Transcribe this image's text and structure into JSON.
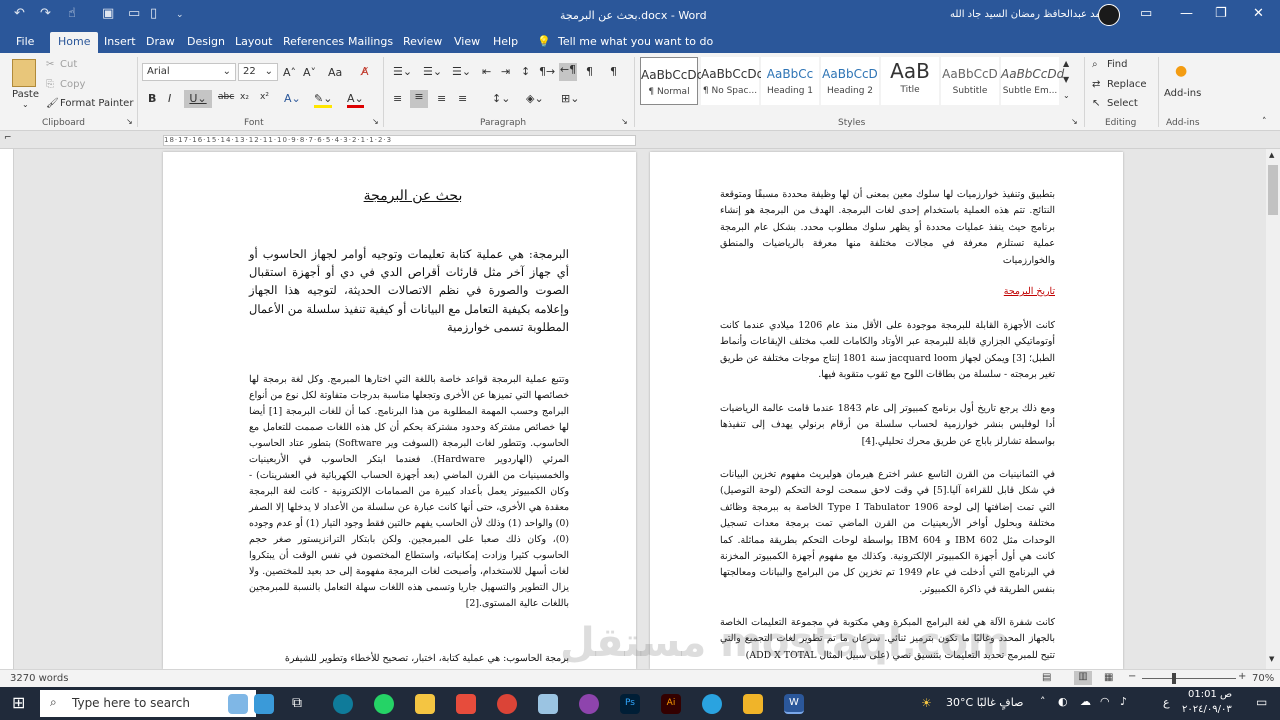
{
  "title_bar": {
    "doc_title": "بحث عن البرمجة.docx  -  Word",
    "user_name": "محمد عبدالحافظ رمضان السيد جاد الله"
  },
  "tabs": [
    "File",
    "Home",
    "Insert",
    "Draw",
    "Design",
    "Layout",
    "References",
    "Mailings",
    "Review",
    "View",
    "Help"
  ],
  "tell_me": "Tell me what you want to do",
  "clipboard": {
    "paste": "Paste",
    "cut": "Cut",
    "copy": "Copy",
    "format_painter": "Format Painter",
    "label": "Clipboard"
  },
  "font": {
    "name": "Arial",
    "size": "22",
    "label": "Font"
  },
  "paragraph": {
    "label": "Paragraph"
  },
  "styles": {
    "label": "Styles",
    "items": [
      {
        "sample": "AaBbCcDd",
        "name": "¶ Normal"
      },
      {
        "sample": "AaBbCcDd",
        "name": "¶ No Spac..."
      },
      {
        "sample": "AaBbCc",
        "name": "Heading 1"
      },
      {
        "sample": "AaBbCcD",
        "name": "Heading 2"
      },
      {
        "sample": "AaB",
        "name": "Title"
      },
      {
        "sample": "AaBbCcD",
        "name": "Subtitle"
      },
      {
        "sample": "AaBbCcDd",
        "name": "Subtle Em..."
      }
    ]
  },
  "editing": {
    "find": "Find",
    "replace": "Replace",
    "select": "Select",
    "label": "Editing"
  },
  "addins": {
    "button": "Add-ins",
    "label": "Add-ins"
  },
  "ruler_text": "18·17·16·15·14·13·12·11·10·9·8·7·6·5·4·3·2·1·1·2·3",
  "left_page": {
    "heading": "بحث عن البرمجة",
    "p1": "البرمجة: هي عملية كتابة تعليمات وتوجيه أوامر لجهاز الحاسوب أو أي جهاز آخر مثل قارئات أقراص الدي في دي أو أجهزة استقبال الصوت والصورة في نظم الاتصالات الحديثة، لتوجيه هذا الجهاز وإعلامه بكيفية التعامل مع البيانات أو كيفية تنفيذ سلسلة من الأعمال المطلوبة تسمى خوارزمية",
    "p2": "وتتبع عملية البرمجة قواعد خاصة باللغة التي اختارها المبرمج. وكل لغة برمجة لها خصائصها التي تميزها عن الأخرى وتجعلها مناسبة بدرجات متفاوتة لكل نوع من أنواع البرامج وحسب المهمة المطلوبة من هذا البرنامج. كما أن للغات البرمجة [1] أيضا لها خصائص مشتركة وحدود مشتركة بحكم أن كل هذه اللغات صممت للتعامل مع الحاسوب. وتتطور لغات البرمجة (السوفت وير Software) بتطور عتاد الحاسوب المرئي (الهاردوير Hardware). فعندما ابتكر الحاسوب في الأربعينيات والخمسينيات من القرن الماضي (بعد أجهزة الحساب الكهربائية في العشرينات) - وكان الكمبيوتر يعمل بأعداد كبيرة من الصمامات الإلكترونية - كانت لغة البرمجة معقدة هي الأخرى، حتى أنها كانت عبارة عن سلسلة من الأعداد لا يدخلها إلا الصفر (0) والواحد (1) وذلك لأن الحاسب يفهم حالتين فقط وجود التيار (1) أو عدم وجوده (0)، وكان ذلك صعبا على المبرمجين. ولكن بابتكار الترانزيستور صغر حجم الحاسوب كثيرا وزادت إمكانياته، واستطاع المختصون في نفس الوقت أن يبتكروا لغات أسهل للاستخدام، وأصبحت لغات البرمجة مفهومة إلى حد بعيد للمختصين. ولا يزال التطوير والتسهيل جاريا وتسمى هذه اللغات سهلة التعامل بالنسبة للمبرمجين باللغات عالية المستوى.[2]",
    "p3": "برمجة الحاسوب: هي عملية كتابة، اختبار، تصحيح للأخطاء وتطوير للشيفرة"
  },
  "right_page": {
    "p1": "بتطبيق وتنفيذ خوارزميات لها سلوك معين بمعنى أن لها وظيفة محددة مسبقًا ومتوقعة النتائج. تتم هذه العملية باستخدام إحدى لغات البرمجة. الهدف من البرمجة هو إنشاء برنامج حيث ينفذ عمليات محددة أو يظهر سلوك مطلوب محدد. بشكل عام البرمجة عملية تستلزم معرفة في مجالات مختلفة منها معرفة بالرياضيات والمنطق والخوارزميات",
    "heading": "تاريخ البرمجة",
    "p2": "كانت الأجهزة القابلة للبرمجة موجودة على الأقل منذ عام 1206 ميلادي عندما كانت أوتوماتيكي الجزاري قابلة للبرمجة عبر الأوتاد والكامات للعب مختلف الإيقاعات وأنماط الطبل؛ [3] ويمكن لجهاز jacquard loom سنة 1801 إنتاج موجات مختلفة عن طريق تغير برمجته - سلسلة من بطاقات اللوح مع ثقوب متقوبة فيها.",
    "p3": "ومع ذلك يرجع تاريخ أول برنامج كمبيوتر إلى عام 1843 عندما قامت عالمة الرياضيات أدا لوفليس بنشر خوارزمية لحساب سلسلة من أرقام برنولي يهدف إلى تنفيذها بواسطة تشارلز باباج عن طريق محرك تحليلي.[4]",
    "p4": "في الثمانينيات من القرن التاسع عشر اخترع هيرمان هوليريث مفهوم تخزين البيانات في شكل قابل للقراءة آليا.[5] في وقت لاحق سمحت لوحة التحكم (لوحة التوصيل) التي تمت إضافتها إلى لوحة Type I Tabulator 1906 الخاصة به ببرمجة وظائف مختلفة وبحلول أواخر الأربعينيات من القرن الماضي تمت برمجة معدات تسجيل الوحدات مثل IBM 602 و IBM 604 بواسطة لوحات التحكم بطريقة مماثلة. كما كانت هي أول أجهزة الكمبيوتر الإلكترونية. وكذلك مع مفهوم أجهزة الكمبيوتر المخزنة في البرنامج التي أدخلت في عام 1949 تم تخزين كل من البرامج والبيانات ومعالجتها بنفس الطريقة في ذاكرة الكمبيوتر.",
    "p5": "كانت شفرة الآلة هي لغة البرامج المبكرة وهي مكتوبة في مجموعة التعليمات الخاصة بالجهاز المحدد وغالبًا ما تكون بترميز ثنائي. سرعان ما تم تطوير لغات التجميع والتي تتيح للمبرمج تحديد التعليمات بتنسيق نصي (على سبيل المثال ADD X TOTAL)"
  },
  "status": {
    "words": "3270 words",
    "zoom": "70%"
  },
  "taskbar": {
    "search_placeholder": "Type here to search",
    "weather": "30°C  صافٍ غالبًا",
    "lang": "ع",
    "time": "01:01 ص",
    "date": "٢٠٢٤/٠٩/٠٣"
  },
  "watermark": "مستقل mostaql.com",
  "colors": {
    "accent": "#2b579a",
    "heading_red": "#c00000"
  }
}
